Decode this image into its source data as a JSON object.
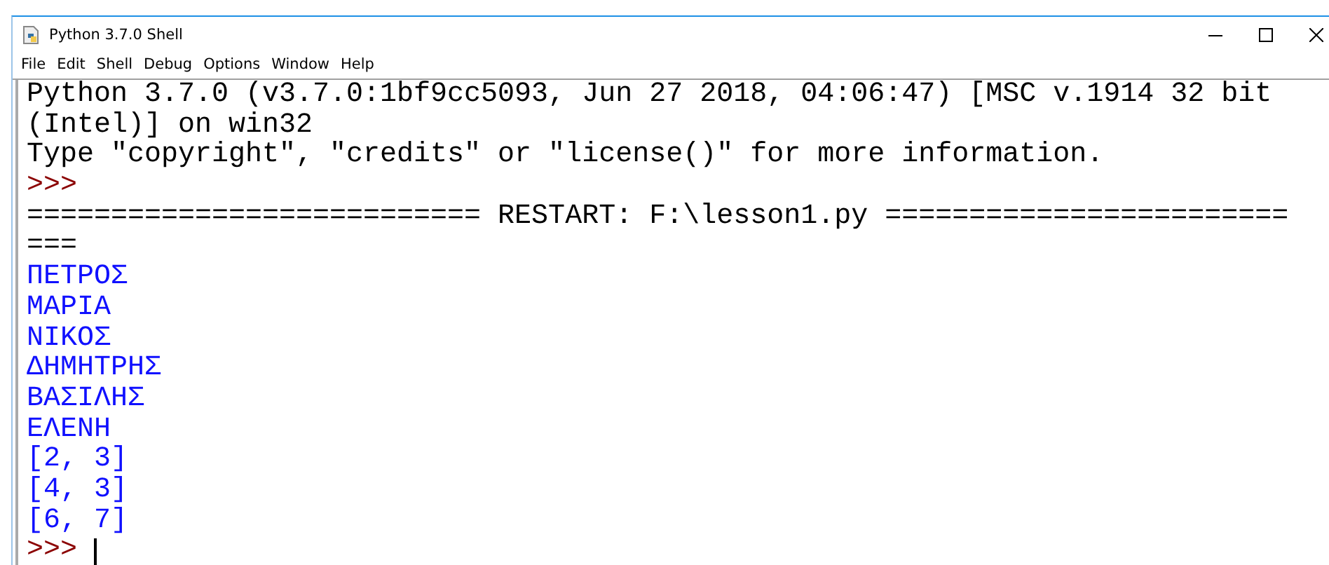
{
  "window": {
    "title": "Python 3.7.0 Shell"
  },
  "menu": [
    "File",
    "Edit",
    "Shell",
    "Debug",
    "Options",
    "Window",
    "Help"
  ],
  "lines": [
    {
      "kind": "text",
      "text": "Python 3.7.0 (v3.7.0:1bf9cc5093, Jun 27 2018, 04:06:47) [MSC v.1914 32 bit"
    },
    {
      "kind": "text",
      "text": "(Intel)] on win32"
    },
    {
      "kind": "text",
      "text": "Type \"copyright\", \"credits\" or \"license()\" for more information."
    },
    {
      "kind": "prompt",
      "text": ">>>"
    },
    {
      "kind": "text",
      "text": "=========================== RESTART: F:\\lesson1.py ========================"
    },
    {
      "kind": "text",
      "text": "==="
    },
    {
      "kind": "output",
      "text": "ΠΕΤΡΟΣ"
    },
    {
      "kind": "output",
      "text": "ΜΑΡΙΑ"
    },
    {
      "kind": "output",
      "text": "ΝΙΚΟΣ"
    },
    {
      "kind": "output",
      "text": "ΔΗΜΗΤΡΗΣ"
    },
    {
      "kind": "output",
      "text": "ΒΑΣΙΛΗΣ"
    },
    {
      "kind": "output",
      "text": "ΕΛΕΝΗ"
    },
    {
      "kind": "output",
      "text": "[2, 3]"
    },
    {
      "kind": "output",
      "text": "[4, 3]"
    },
    {
      "kind": "output",
      "text": "[6, 7]"
    },
    {
      "kind": "input",
      "text": ">>>"
    }
  ]
}
